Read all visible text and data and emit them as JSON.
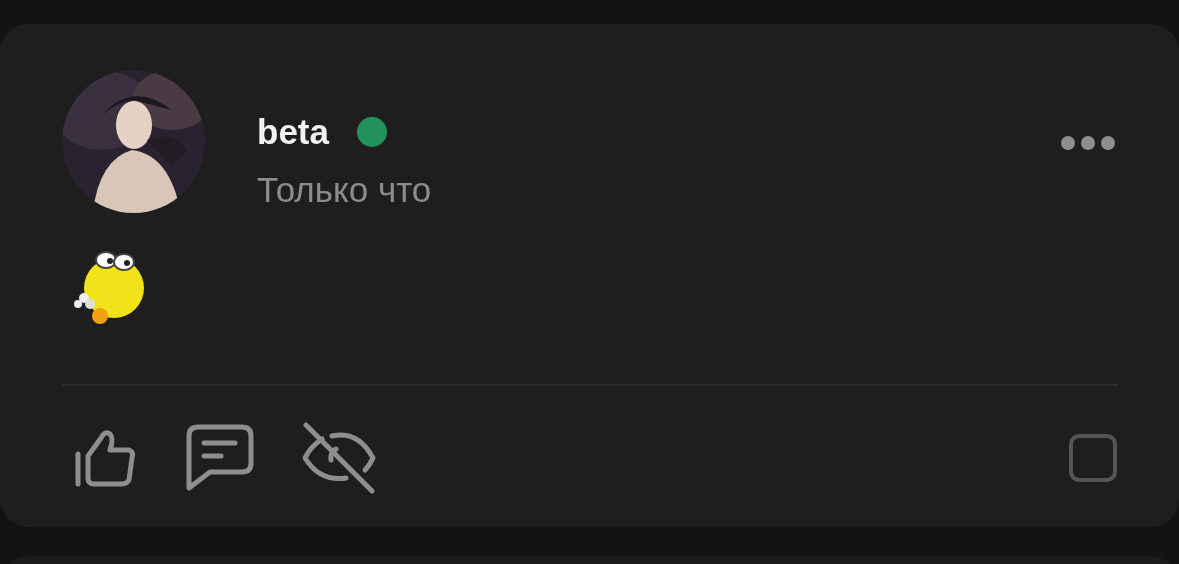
{
  "post": {
    "author": {
      "name": "beta",
      "online": true
    },
    "time": "Только что",
    "content": {
      "kind": "sticker"
    },
    "select_checkbox": {
      "checked": false
    }
  }
}
